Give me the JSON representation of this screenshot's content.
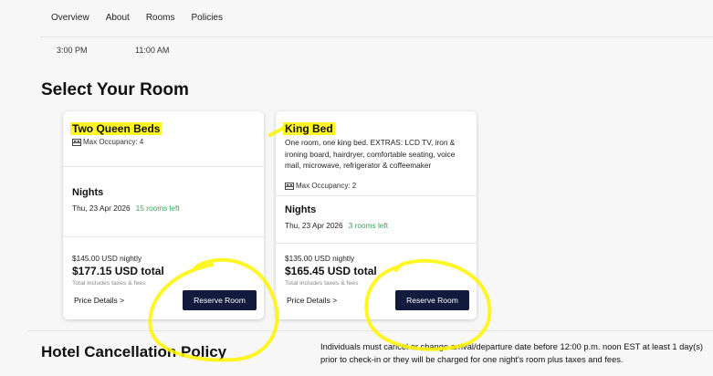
{
  "nav": {
    "tabs": [
      "Overview",
      "About",
      "Rooms",
      "Policies"
    ]
  },
  "times": {
    "check_in": "3:00 PM",
    "check_out": "11:00 AM"
  },
  "section_title": "Select Your Room",
  "rooms": [
    {
      "name": "Two Queen Beds",
      "occupancy": "Max Occupancy: 4",
      "nights_label": "Nights",
      "date": "Thu, 23 Apr 2026",
      "availability": "15 rooms left",
      "nightly": "$145.00 USD nightly",
      "total": "$177.15 USD total",
      "taxes_note": "Total includes taxes & fees",
      "price_details": "Price Details >",
      "reserve": "Reserve Room"
    },
    {
      "name": "King Bed",
      "description": "One room, one king bed. EXTRAS: LCD TV, iron & ironing board, hairdryer, comfortable seating, voice mail, microwave, refrigerator & coffeemaker",
      "occupancy": "Max Occupancy: 2",
      "nights_label": "Nights",
      "date": "Thu, 23 Apr 2026",
      "availability": "3 rooms left",
      "nightly": "$135.00 USD nightly",
      "total": "$165.45 USD total",
      "taxes_note": "Total includes taxes & fees",
      "price_details": "Price Details >",
      "reserve": "Reserve Room"
    }
  ],
  "policy": {
    "title": "Hotel Cancellation Policy",
    "text": "Individuals must cancel or change arrival/departure date before 12:00 p.m. noon EST at least 1 day(s) prior to check-in or they will be charged for one night's room plus taxes and fees."
  },
  "colors": {
    "highlight": "#fff500",
    "button": "#121a3d",
    "availability": "#3aa55a"
  },
  "icons": {
    "occupancy": "bed-icon"
  }
}
